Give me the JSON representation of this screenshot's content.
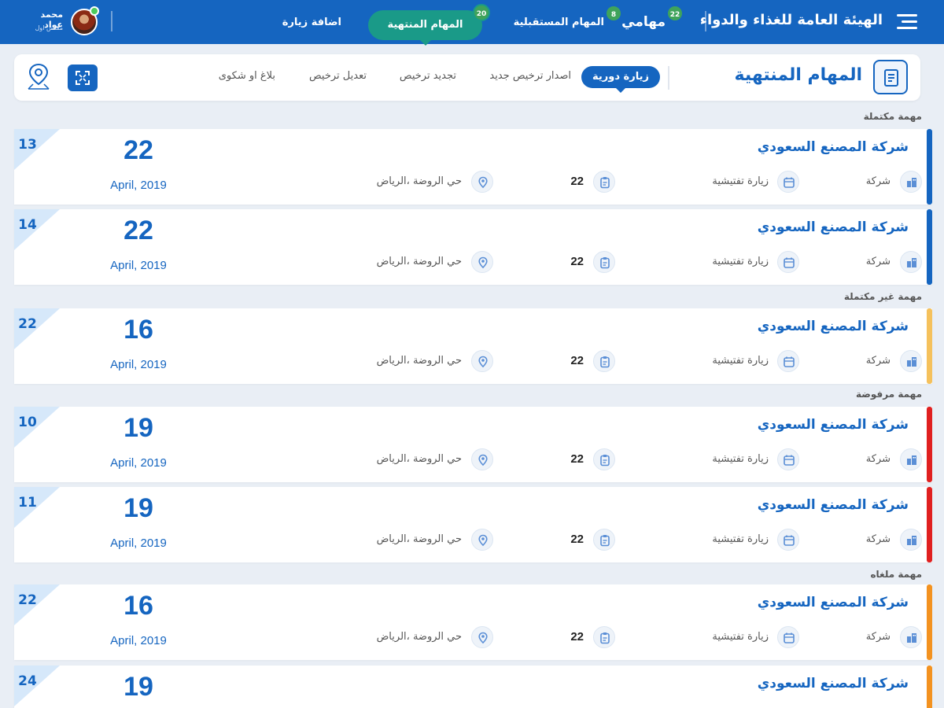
{
  "brand": "الهيئة العامة للغذاء والدواء",
  "nav": {
    "my_tasks": {
      "label": "مهامي",
      "badge": "22"
    },
    "upcoming": {
      "label": "المهام المستقبلية",
      "badge": "8"
    },
    "finished": {
      "label": "المهام المنتهية",
      "badge": "20"
    },
    "add_visit": {
      "label": "اضافة زيارة"
    }
  },
  "user": {
    "name": "محمد عواد",
    "role": "مفتش اول"
  },
  "page": {
    "title": "المهام المنتهية",
    "tabs": [
      "زيارة دورية",
      "اصدار ترخيص جديد",
      "تجديد ترخيص",
      "تعديل ترخيص",
      "بلاغ او شكوى"
    ]
  },
  "sections": {
    "completed": "مهمة مكتملة",
    "incomplete": "مهمة غير مكتملة",
    "rejected": "مهمة مرفوضة",
    "cancelled": "مهمة ملغاه"
  },
  "colors": {
    "primary": "#1565c0",
    "completed": "#1565c0",
    "incomplete": "#f5c15c",
    "rejected": "#e02020",
    "cancelled": "#f39220"
  },
  "cards": [
    {
      "num": "13",
      "day": "22",
      "month": "April, 2019",
      "company": "شركة المصنع السعودي",
      "type": "شركة",
      "visit": "زيارة تفتيشية",
      "count": "22",
      "location": "حي الروضة ،الرياض",
      "status": "completed"
    },
    {
      "num": "14",
      "day": "22",
      "month": "April, 2019",
      "company": "شركة المصنع السعودي",
      "type": "شركة",
      "visit": "زيارة تفتيشية",
      "count": "22",
      "location": "حي الروضة ،الرياض",
      "status": "completed"
    },
    {
      "num": "22",
      "day": "16",
      "month": "April, 2019",
      "company": "شركة المصنع السعودي",
      "type": "شركة",
      "visit": "زيارة تفتيشية",
      "count": "22",
      "location": "حي الروضة ،الرياض",
      "status": "incomplete"
    },
    {
      "num": "10",
      "day": "19",
      "month": "April, 2019",
      "company": "شركة المصنع السعودي",
      "type": "شركة",
      "visit": "زيارة تفتيشية",
      "count": "22",
      "location": "حي الروضة ،الرياض",
      "status": "rejected"
    },
    {
      "num": "11",
      "day": "19",
      "month": "April, 2019",
      "company": "شركة المصنع السعودي",
      "type": "شركة",
      "visit": "زيارة تفتيشية",
      "count": "22",
      "location": "حي الروضة ،الرياض",
      "status": "rejected"
    },
    {
      "num": "22",
      "day": "16",
      "month": "April, 2019",
      "company": "شركة المصنع السعودي",
      "type": "شركة",
      "visit": "زيارة تفتيشية",
      "count": "22",
      "location": "حي الروضة ،الرياض",
      "status": "cancelled"
    },
    {
      "num": "24",
      "day": "19",
      "month": "",
      "company": "شركة المصنع السعودي",
      "type": "",
      "visit": "",
      "count": "",
      "location": "",
      "status": "cancelled"
    }
  ]
}
